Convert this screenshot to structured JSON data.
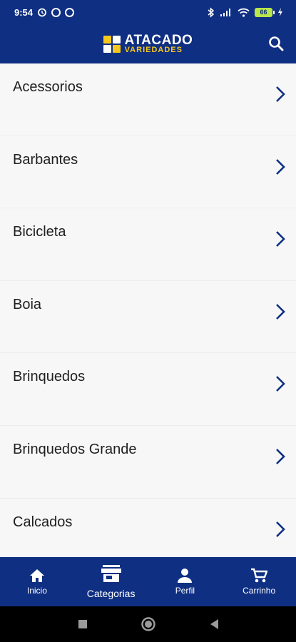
{
  "status_bar": {
    "time": "9:54",
    "battery": "66"
  },
  "header": {
    "brand_name": "ATACADO",
    "brand_tagline": "VARIEDADES",
    "search_icon": "search-icon",
    "color": "#0f2f83",
    "accent": "#f7c71c"
  },
  "categories": [
    {
      "label": "Acessorios"
    },
    {
      "label": "Barbantes"
    },
    {
      "label": "Bicicleta"
    },
    {
      "label": "Boia"
    },
    {
      "label": "Brinquedos"
    },
    {
      "label": "Brinquedos Grande"
    },
    {
      "label": "Calcados"
    }
  ],
  "bottom_nav": {
    "items": [
      {
        "label": "Inicio",
        "icon": "home-icon"
      },
      {
        "label": "Categorias",
        "icon": "store-icon",
        "active": true
      },
      {
        "label": "Perfil",
        "icon": "person-icon"
      },
      {
        "label": "Carrinho",
        "icon": "cart-icon"
      }
    ]
  },
  "system_nav": {
    "icons": [
      "recents-icon",
      "home-circle-icon",
      "back-icon"
    ]
  }
}
